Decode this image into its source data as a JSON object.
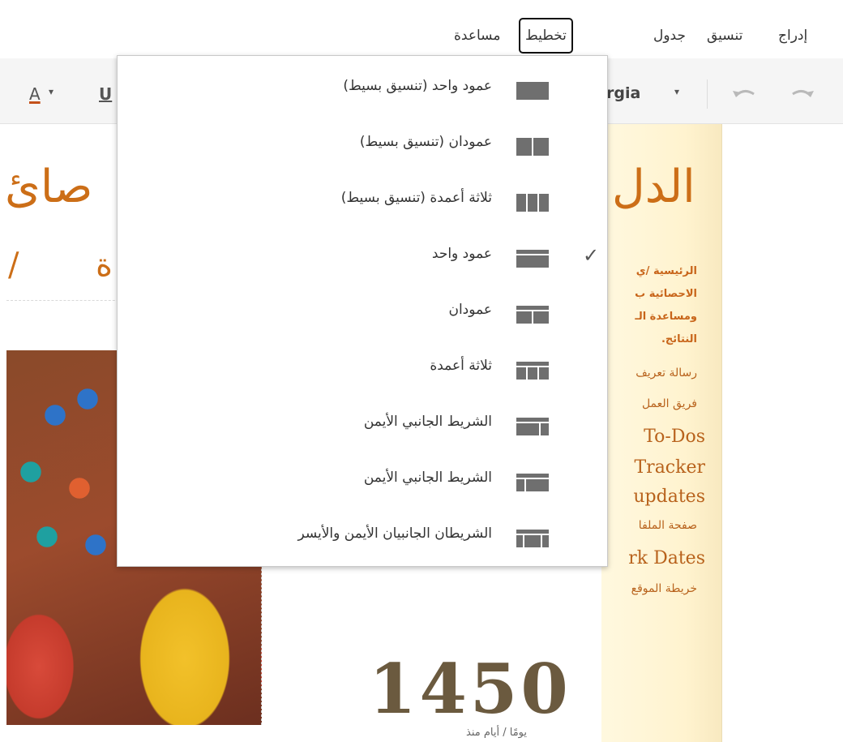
{
  "menubar": {
    "items": [
      {
        "label": "إدراج"
      },
      {
        "label": "تنسيق"
      },
      {
        "label": "جدول"
      },
      {
        "label": "تخطيط",
        "active": true
      },
      {
        "label": "مساعدة"
      }
    ]
  },
  "toolbar": {
    "font_color": "A",
    "underline": "U",
    "font_name": "rgia",
    "dropdown_arrow": "▾"
  },
  "document": {
    "heading_right": "الدل",
    "heading_left": "صائ",
    "subheading_left": "/",
    "subheading_mid": "ة",
    "sidebar_lines": [
      "الرئيسية /ي",
      "الاحصائية ب",
      "ومساعدة الـ",
      "النتائج."
    ],
    "sidebar_links_ar": [
      "رسالة تعريف",
      "فريق العمل"
    ],
    "sidebar_links_en": [
      "To-Dos",
      "Tracker",
      "updates"
    ],
    "sidebar_link_files": "صفحة الملفا",
    "sidebar_link_bench": "rk Dates",
    "sidebar_sitemap": "خريطة الموقع",
    "counter": "1450",
    "counter_sub": "يومًا / أيام منذ"
  },
  "layout_menu": {
    "items": [
      {
        "label": "عمود واحد (تنسيق بسيط)",
        "icon": "one-column-simple-icon",
        "checked": false
      },
      {
        "label": "عمودان (تنسيق بسيط)",
        "icon": "two-columns-simple-icon",
        "checked": false
      },
      {
        "label": "ثلاثة أعمدة (تنسيق بسيط)",
        "icon": "three-columns-simple-icon",
        "checked": false
      },
      {
        "label": "عمود واحد",
        "icon": "one-column-icon",
        "checked": true
      },
      {
        "label": "عمودان",
        "icon": "two-columns-icon",
        "checked": false
      },
      {
        "label": "ثلاثة أعمدة",
        "icon": "three-columns-icon",
        "checked": false
      },
      {
        "label": "الشريط الجانبي الأيمن",
        "icon": "right-sidebar-icon",
        "checked": false
      },
      {
        "label": "الشريط الجانبي الأيمن",
        "icon": "right-sidebar-alt-icon",
        "checked": false
      },
      {
        "label": "الشريطان الجانبيان الأيمن والأيسر",
        "icon": "both-sidebars-icon",
        "checked": false
      }
    ],
    "check_glyph": "✓"
  },
  "colors": {
    "heading": "#cc6e17",
    "counter": "#6b5a3f",
    "sidebar_bg": "#fff3cf",
    "icon": "#7a7a7a"
  }
}
